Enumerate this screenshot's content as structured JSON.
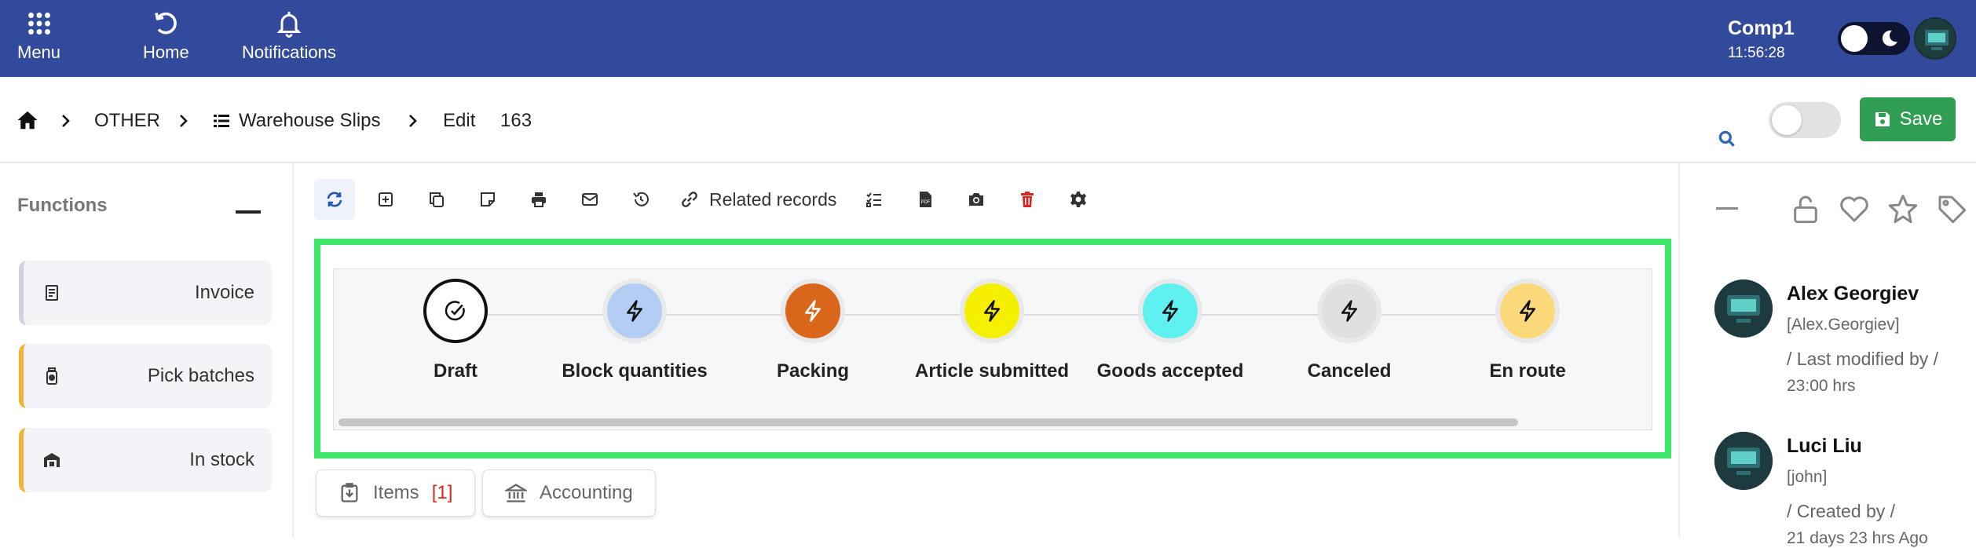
{
  "topbar": {
    "menu_label": "Menu",
    "home_label": "Home",
    "notifications_label": "Notifications",
    "company": "Comp1",
    "time": "11:56:28",
    "bg_color": "#324a9b"
  },
  "breadcrumb": {
    "section": "OTHER",
    "module": "Warehouse Slips",
    "action": "Edit",
    "record_id": "163"
  },
  "actions": {
    "save_label": "Save",
    "save_color": "#2f9e52"
  },
  "functions": {
    "title": "Functions",
    "items": [
      {
        "label": "Invoice",
        "icon": "receipt-icon"
      },
      {
        "label": "Pick batches",
        "icon": "jar-icon"
      },
      {
        "label": "In stock",
        "icon": "warehouse-icon"
      }
    ]
  },
  "toolbar": {
    "related_label": "Related records",
    "icons": [
      "refresh-icon",
      "add-box-icon",
      "copy-icon",
      "note-icon",
      "print-icon",
      "mail-icon",
      "history-icon",
      "link-icon",
      "checklist-icon",
      "pdf-icon",
      "camera-icon",
      "trash-icon",
      "gear-icon"
    ]
  },
  "workflow": {
    "steps": [
      {
        "label": "Draft",
        "color": "#ffffff",
        "state": "done"
      },
      {
        "label": "Block quantities",
        "color": "#b3cdf5"
      },
      {
        "label": "Packing",
        "color": "#d9661b"
      },
      {
        "label": "Article submitted",
        "color": "#f5f000"
      },
      {
        "label": "Goods accepted",
        "color": "#5ff0f0"
      },
      {
        "label": "Canceled",
        "color": "#e0e0e0"
      },
      {
        "label": "En route",
        "color": "#fbd97a"
      }
    ],
    "highlight_color": "#3ee66a"
  },
  "tabs": [
    {
      "label": "Items",
      "count": "[1]"
    },
    {
      "label": "Accounting"
    }
  ],
  "activity": [
    {
      "name": "Alex Georgiev",
      "login": "[Alex.Georgiev]",
      "action": "/ Last modified by /",
      "time": "23:00 hrs"
    },
    {
      "name": "Luci Liu",
      "login": "[john]",
      "action": "/ Created by /",
      "time": "21 days 23 hrs Ago"
    }
  ]
}
